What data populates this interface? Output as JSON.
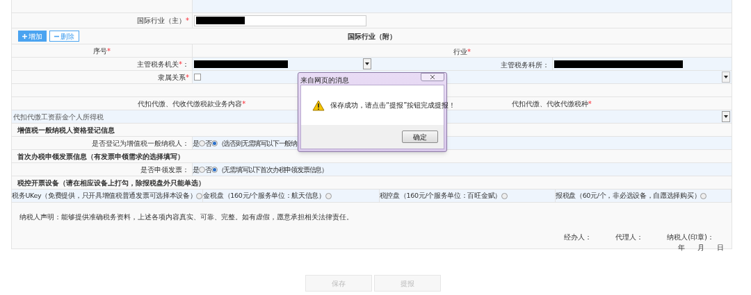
{
  "industry_main": {
    "label": "国际行业（主）",
    "mark": "*",
    "value_redacted": true
  },
  "industry_sub": {
    "add_button": "增加",
    "delete_button": "删除",
    "title": "国际行业（附）",
    "columns": [
      {
        "label": "序号",
        "mark": "*"
      },
      {
        "label": "行业",
        "mark": "*"
      }
    ]
  },
  "tax_office": {
    "label": "主管税务机关",
    "mark": "*",
    "suffix": "：",
    "value_redacted": true,
    "section_label": "主管税务科所：",
    "section_redacted": true
  },
  "affiliation": {
    "label": "隶属关系",
    "mark": "*",
    "checked": false
  },
  "withholding": {
    "columns": [
      {
        "label": "代扣代缴、代收代缴税款业务内容",
        "mark": "*"
      },
      {
        "label": "代扣代缴、代收代缴税种",
        "mark": "*"
      }
    ],
    "value": "代扣代缴工资薪金个人所得税"
  },
  "sections": [
    {
      "title": "增值税一般纳税人资格登记信息",
      "label": "是否登记为增值税一般纳税人：",
      "options": [
        {
          "label": "是",
          "selected": false
        },
        {
          "label": "否",
          "selected": true
        }
      ],
      "note": "（选否则无需填写以下一般纳"
    },
    {
      "title": "首次办税申领发票信息（有发票申领需求的选择填写）",
      "label": "是否申领发票：",
      "options": [
        {
          "label": "是",
          "selected": false
        },
        {
          "label": "否",
          "selected": true
        }
      ],
      "note": "（无需填写以下首次办税申领发票信息）"
    }
  ],
  "devices": {
    "title": "税控开票设备（请在相应设备上打勾，除报税盘外只能单选）",
    "items": [
      {
        "label": "税务UKey（免费提供，只开具增值税普通发票可选择本设备）",
        "selected": false
      },
      {
        "label": "金税盘（160元/个服务单位：航天信息）",
        "selected": false
      },
      {
        "label": "税控盘（160元/个服务单位：百旺金赋）",
        "selected": false
      },
      {
        "label": "报税盘（60元/个，非必选设备，自愿选择购买）",
        "selected": false
      }
    ]
  },
  "declaration": {
    "text": "纳税人声明：能够提供准确税务资料，上述各项内容真实、可靠、完整。如有虚假，愿意承担相关法律责任。",
    "signatures": [
      "经办人：",
      "代理人：",
      "纳税人(印章)："
    ],
    "date": [
      "年",
      "月",
      "日"
    ]
  },
  "buttons": [
    {
      "label": "保存",
      "disabled": true
    },
    {
      "label": "提报",
      "disabled": true
    }
  ],
  "dialog": {
    "title": "来自网页的消息",
    "message": "保存成功，请点击“提报”按钮完成提报！",
    "ok": "确定"
  }
}
